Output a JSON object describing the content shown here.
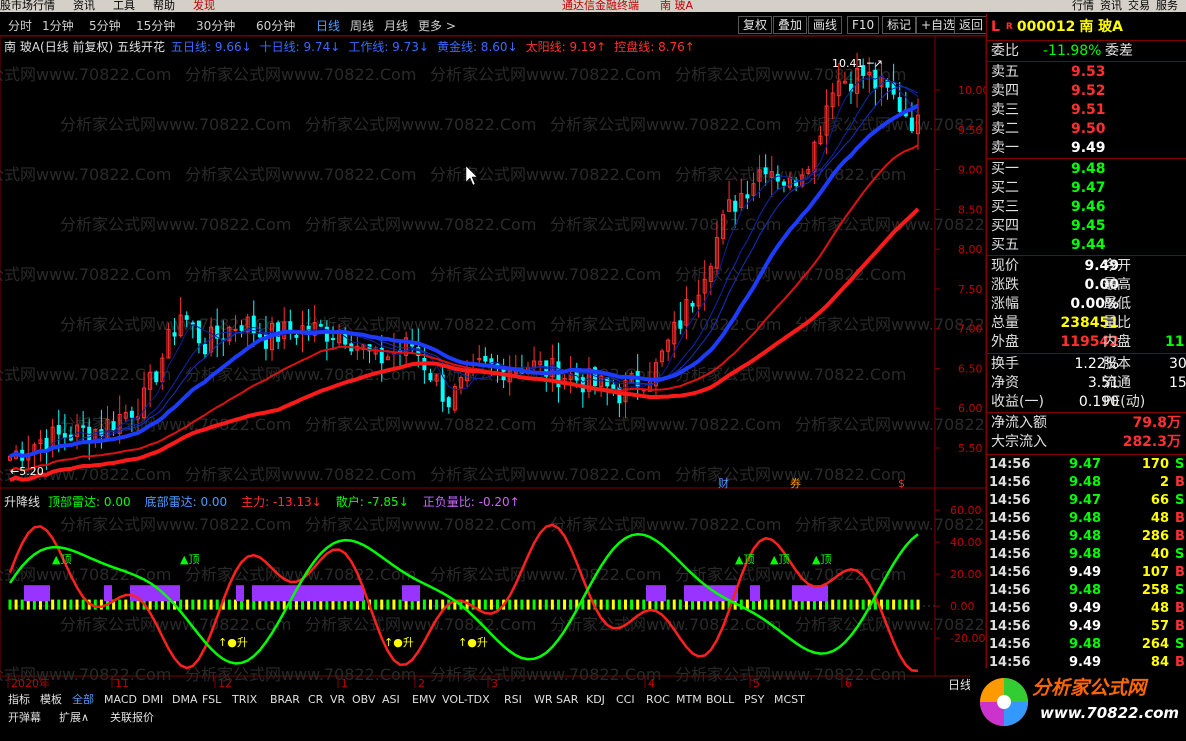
{
  "menubar": {
    "items": [
      "股市场行情",
      "资讯",
      "工具",
      "帮助"
    ],
    "highlight": "发现",
    "title": "通达信金融终端",
    "stock_title": "南 玻A",
    "right_items": [
      "行情",
      "资讯",
      "交易",
      "服务"
    ]
  },
  "periods": [
    "分时",
    "1分钟",
    "5分钟",
    "15分钟",
    "30分钟",
    "60分钟",
    "日线",
    "周线",
    "月线",
    "更多 >"
  ],
  "active_period": "日线",
  "toolbar_buttons": [
    "复权",
    "叠加",
    "画线",
    "F10",
    "标记",
    "+自选",
    "返回"
  ],
  "main_info": {
    "title": "南 玻A(日线 前复权) 五线开花",
    "lines": [
      {
        "label": "五日线: 9.66↓",
        "color": "#3a6bff"
      },
      {
        "label": "十日线: 9.74↓",
        "color": "#3a6bff"
      },
      {
        "label": "工作线: 9.73↓",
        "color": "#3a6bff"
      },
      {
        "label": "黄金线: 8.60↓",
        "color": "#3a6bff"
      },
      {
        "label": "太阳线: 9.19↑",
        "color": "#ff3030"
      },
      {
        "label": "控盘线: 8.76↑",
        "color": "#ff3030"
      }
    ]
  },
  "price_axis": [
    "10.00",
    "9.50",
    "9.00",
    "8.50",
    "8.00",
    "7.50",
    "7.00",
    "6.50",
    "6.00",
    "5.50"
  ],
  "high_mark": "10.41",
  "low_mark": "5.20",
  "event_marks": [
    "财",
    "券",
    "$"
  ],
  "indicator2": {
    "title": "升降线",
    "items": [
      {
        "label": "顶部雷达: 0.00",
        "color": "#00ff00"
      },
      {
        "label": "底部雷达: 0.00",
        "color": "#4f9bff"
      },
      {
        "label": "主力: -13.13↓",
        "color": "#ff3030"
      },
      {
        "label": "散户: -7.85↓",
        "color": "#00ff00"
      },
      {
        "label": "正负量比: -0.20↑",
        "color": "#cc66ff"
      }
    ],
    "axis": [
      "60.00",
      "40.00",
      "20.00",
      "0.00",
      "-20.00"
    ],
    "marks_top": [
      "顶",
      "顶",
      "顶",
      "顶",
      "顶"
    ],
    "marks_bottom": [
      "升",
      "升",
      "升"
    ]
  },
  "date_axis": [
    "2020年",
    "11",
    "12",
    "1",
    "2",
    "3",
    "4",
    "5",
    "6"
  ],
  "right_panel": {
    "code": "000012",
    "name": "南 玻A",
    "prefix": "L",
    "r_mark": "R",
    "weibi_label": "委比",
    "weibi_value": "-11.98%",
    "weicha_label": "委差",
    "asks": [
      {
        "label": "卖五",
        "price": "9.53"
      },
      {
        "label": "卖四",
        "price": "9.52"
      },
      {
        "label": "卖三",
        "price": "9.51"
      },
      {
        "label": "卖二",
        "price": "9.50"
      },
      {
        "label": "卖一",
        "price": "9.49"
      }
    ],
    "bids": [
      {
        "label": "买一",
        "price": "9.48"
      },
      {
        "label": "买二",
        "price": "9.47"
      },
      {
        "label": "买三",
        "price": "9.46"
      },
      {
        "label": "买四",
        "price": "9.45"
      },
      {
        "label": "买五",
        "price": "9.44"
      }
    ],
    "stats": [
      {
        "label": "现价",
        "value": "9.49",
        "label2": "今开",
        "value_color": "#ffffff"
      },
      {
        "label": "涨跌",
        "value": "0.00",
        "label2": "最高",
        "value_color": "#ffffff"
      },
      {
        "label": "涨幅",
        "value": "0.00%",
        "label2": "最低",
        "value_color": "#ffffff"
      },
      {
        "label": "总量",
        "value": "238451",
        "label2": "量比",
        "value_color": "#ffff00"
      },
      {
        "label": "外盘",
        "value": "119542",
        "label2": "内盘",
        "value_color": "#ff3030",
        "value2": "11",
        "value2_color": "#00ff00"
      }
    ],
    "stats2": [
      {
        "label": "换手",
        "value": "1.22%",
        "label2": "股本",
        "value2": "30"
      },
      {
        "label": "净资",
        "value": "3.51",
        "label2": "流通",
        "value2": "15"
      },
      {
        "label": "收益(一)",
        "value": "0.190",
        "label2": "PE(动)",
        "value2": ""
      }
    ],
    "flows": [
      {
        "label": "净流入额",
        "value": "79.8万"
      },
      {
        "label": "大宗流入",
        "value": "282.3万"
      }
    ],
    "ticks": [
      {
        "time": "14:56",
        "price": "9.47",
        "vol": "170",
        "side": "S"
      },
      {
        "time": "14:56",
        "price": "9.48",
        "vol": "2",
        "side": "B"
      },
      {
        "time": "14:56",
        "price": "9.47",
        "vol": "66",
        "side": "S"
      },
      {
        "time": "14:56",
        "price": "9.48",
        "vol": "48",
        "side": "B"
      },
      {
        "time": "14:56",
        "price": "9.48",
        "vol": "286",
        "side": "B"
      },
      {
        "time": "14:56",
        "price": "9.48",
        "vol": "40",
        "side": "S"
      },
      {
        "time": "14:56",
        "price": "9.49",
        "vol": "107",
        "side": "B"
      },
      {
        "time": "14:56",
        "price": "9.48",
        "vol": "258",
        "side": "S"
      },
      {
        "time": "14:56",
        "price": "9.49",
        "vol": "48",
        "side": "B"
      },
      {
        "time": "14:56",
        "price": "9.49",
        "vol": "57",
        "side": "B"
      },
      {
        "time": "14:56",
        "price": "9.48",
        "vol": "264",
        "side": "S"
      },
      {
        "time": "14:56",
        "price": "9.49",
        "vol": "84",
        "side": "B"
      }
    ],
    "period_label": "日线"
  },
  "bottom_tabs_row1": [
    "指标",
    "模板",
    "全部",
    "MACD",
    "DMI",
    "DMA",
    "FSL",
    "TRIX",
    "BRAR",
    "CR",
    "VR",
    "OBV",
    "ASI",
    "EMV",
    "VOL-TDX",
    "RSI",
    "WR",
    "SAR",
    "KDJ",
    "CCI",
    "ROC",
    "MTM",
    "BOLL",
    "PSY",
    "MCST"
  ],
  "bottom_tabs_row2": [
    "开弹幕",
    "扩展∧",
    "关联报价"
  ],
  "active_tab": "全部",
  "watermark": "分析家公式网www.70822.Com",
  "logo": {
    "title": "分析家公式网",
    "url": "www.70822.com"
  },
  "colors": {
    "up": "#ff3030",
    "down": "#00ffff",
    "ma_blue": "#1e3cff",
    "ma_red": "#ff1a1a",
    "grid": "#800000",
    "green": "#00ff00",
    "yellow": "#ffff00",
    "purple": "#9933ff"
  }
}
